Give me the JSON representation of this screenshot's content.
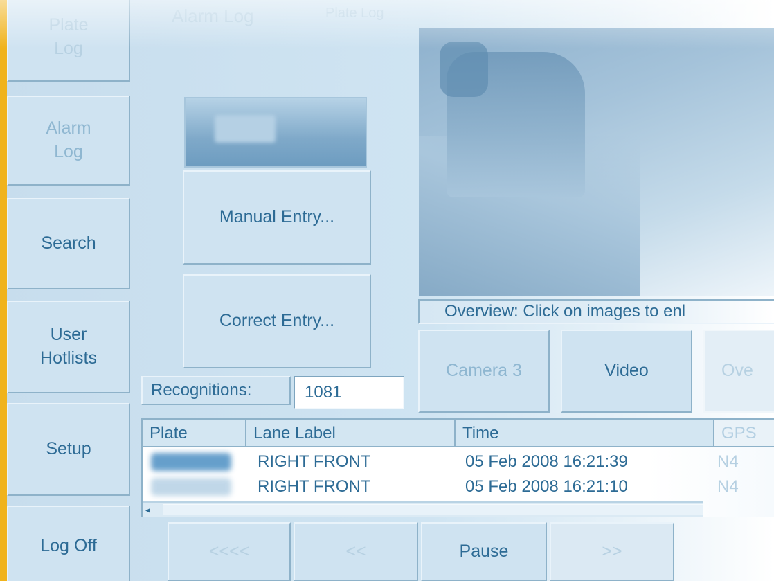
{
  "sidebar": {
    "items": [
      {
        "label": "Plate\nLog"
      },
      {
        "label": "Alarm\nLog"
      },
      {
        "label": "Search"
      },
      {
        "label": "User\nHotlists"
      },
      {
        "label": "Setup"
      },
      {
        "label": "Log Off"
      }
    ]
  },
  "header": {
    "tab1": "Alarm Log",
    "tab2": "Plate Log"
  },
  "actions": {
    "manual_entry": "Manual Entry...",
    "correct_entry": "Correct Entry..."
  },
  "camera": {
    "caption": "Overview: Click on images to enl",
    "buttons": [
      "Camera 3",
      "Video",
      "Ove"
    ]
  },
  "recognitions": {
    "label": "Recognitions:",
    "value": "1081"
  },
  "table": {
    "columns": [
      "Plate",
      "Lane Label",
      "Time",
      "GPS"
    ],
    "rows": [
      {
        "plate": "",
        "lane": "RIGHT FRONT",
        "time": "05 Feb 2008 16:21:39",
        "gps": "N4"
      },
      {
        "plate": "",
        "lane": "RIGHT FRONT",
        "time": "05 Feb 2008 16:21:10",
        "gps": "N4"
      }
    ]
  },
  "playback": {
    "buttons": [
      "<<<<",
      "<<",
      "Pause",
      ">>"
    ]
  },
  "colors": {
    "accent": "#f0b31c",
    "text": "#2d6b95",
    "panel": "#cfe3f1"
  }
}
